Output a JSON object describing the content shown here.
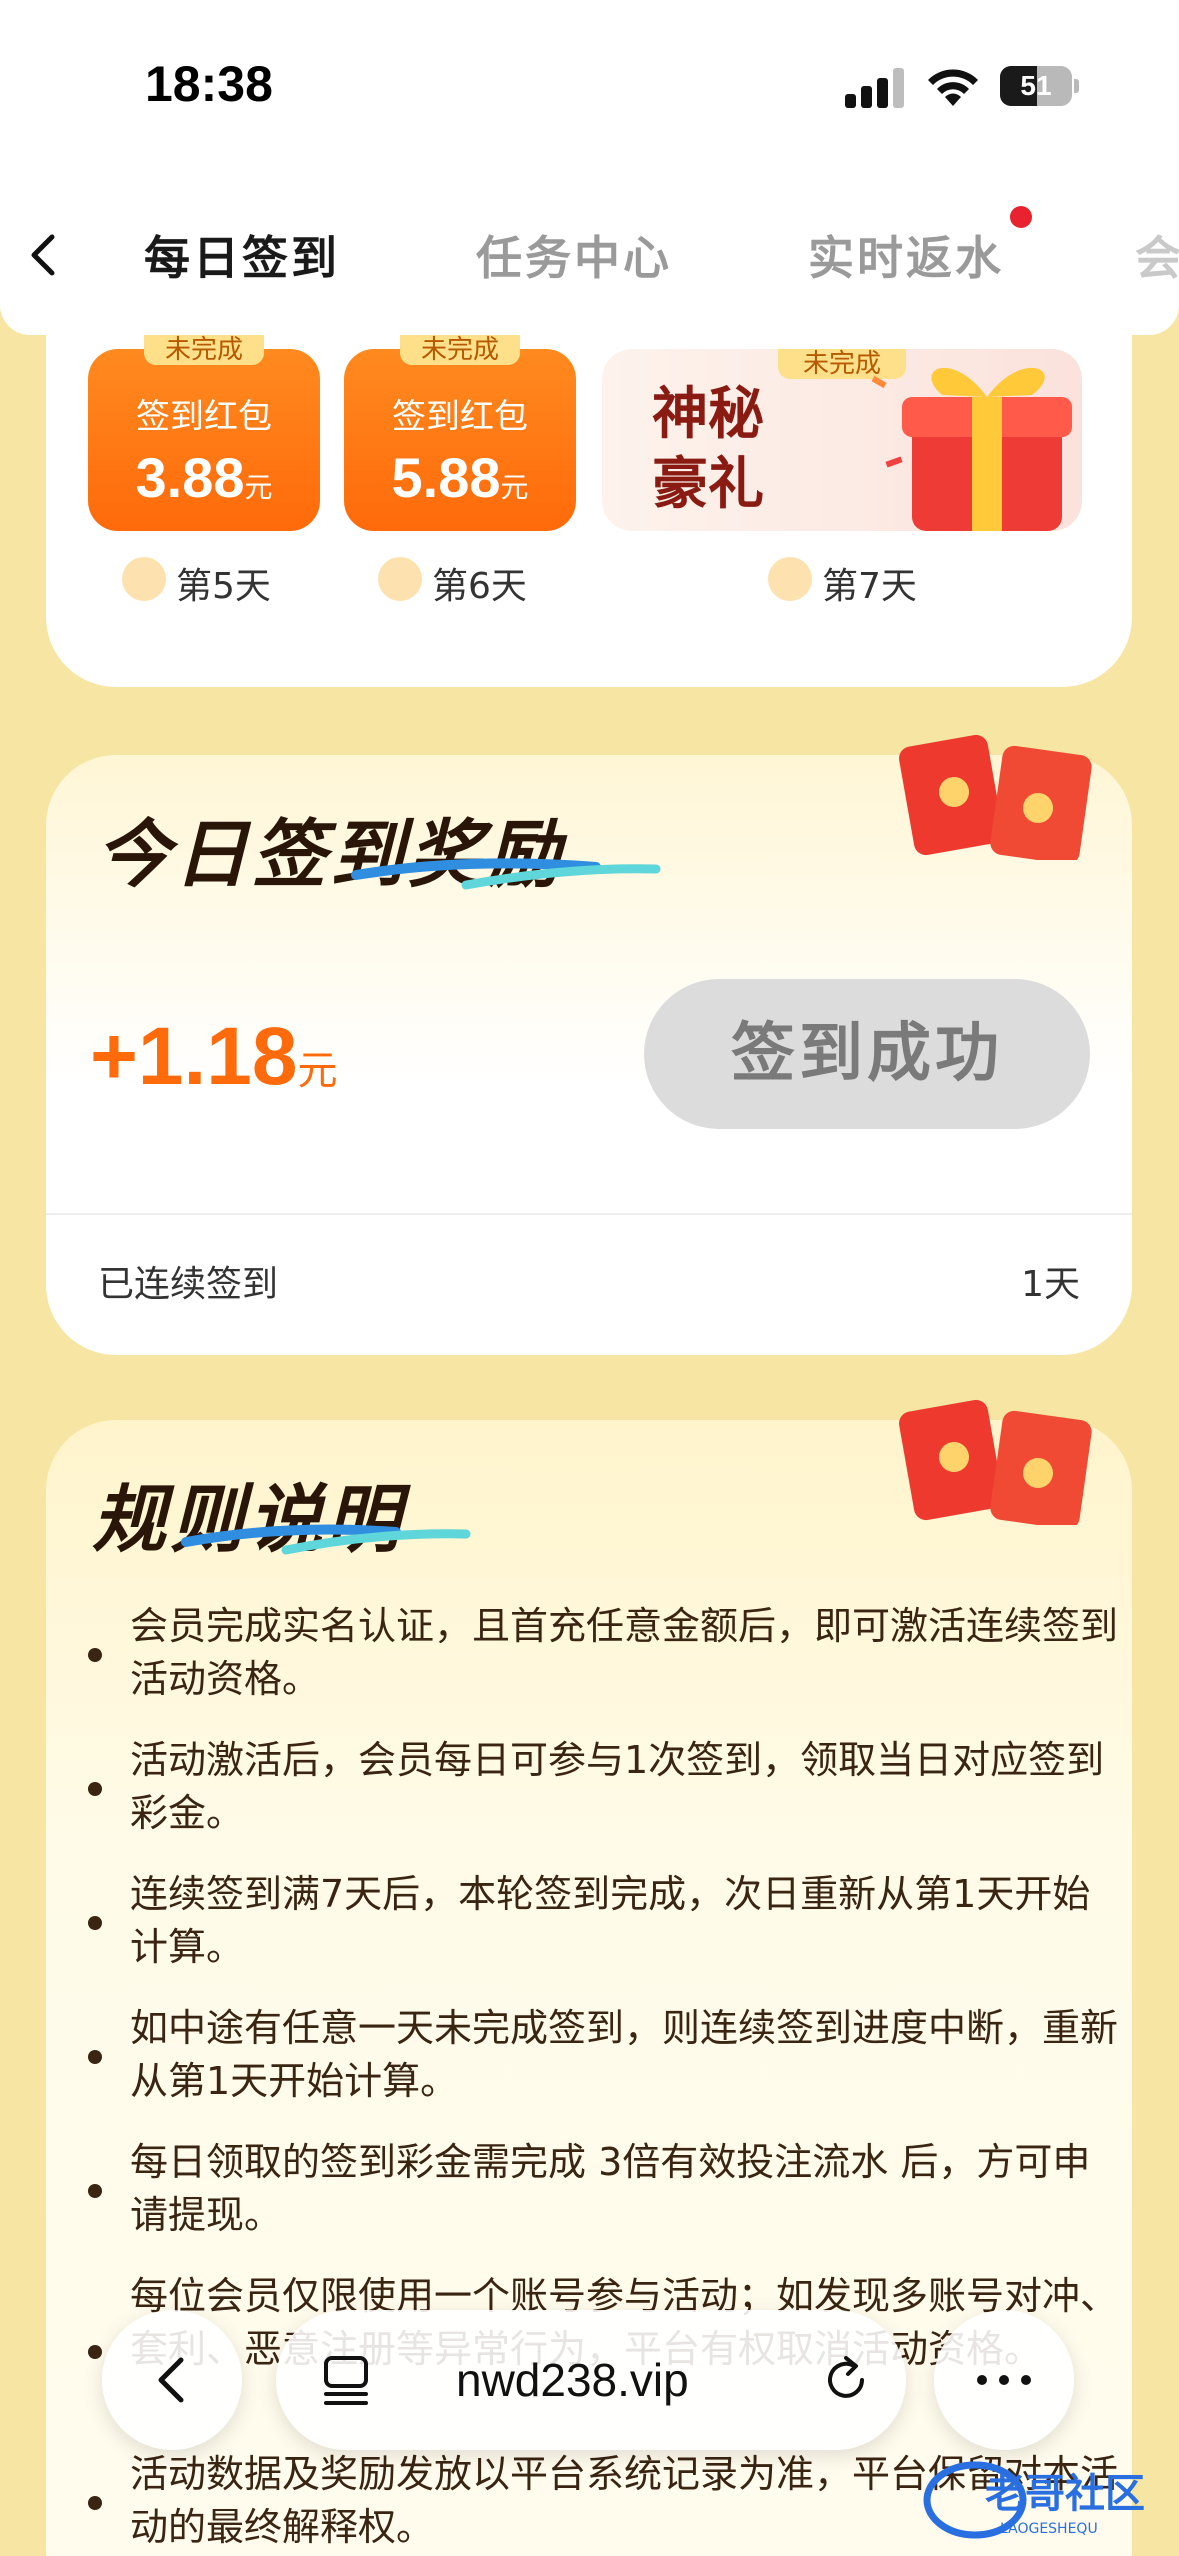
{
  "status": {
    "time": "18:38",
    "battery": "51",
    "battery_level": 0.51
  },
  "tabs": [
    {
      "label": "每日签到",
      "active": true
    },
    {
      "label": "任务中心",
      "active": false
    },
    {
      "label": "实时返水",
      "active": false,
      "has_dot": true
    }
  ],
  "days": [
    {
      "tag": "未完成",
      "title": "签到红包",
      "amount": "3.88",
      "unit": "元",
      "day": "第5天"
    },
    {
      "tag": "未完成",
      "title": "签到红包",
      "amount": "5.88",
      "unit": "元",
      "day": "第6天"
    },
    {
      "tag": "未完成",
      "title": "神秘豪礼",
      "day": "第7天"
    }
  ],
  "reward": {
    "title": "今日签到奖励",
    "amount": "+1.18",
    "unit": "元",
    "button": "签到成功",
    "streak_label": "已连续签到",
    "streak_value": "1天"
  },
  "rules": {
    "title": "规则说明",
    "items": [
      "会员完成实名认证，且首充任意金额后，即可激活连续签到活动资格。",
      "活动激活后，会员每日可参与1次签到，领取当日对应签到彩金。",
      "连续签到满7天后，本轮签到完成，次日重新从第1天开始计算。",
      "如中途有任意一天未完成签到，则连续签到进度中断，重新从第1天开始计算。",
      "每日领取的签到彩金需完成 3倍有效投注流水 后，方可申请提现。",
      "每位会员仅限使用一个账号参与活动；如发现多账号对冲、套利、恶意注册等异常行为，平台有权取消活动资格。",
      "活动数据及奖励发放以平台系统记录为准，平台保留对本活动的最终解释权。"
    ]
  },
  "browser": {
    "url": "nwd238.vip"
  },
  "watermark": {
    "text": "老哥社区",
    "subtext": "LAOGESHEQU"
  },
  "colors": {
    "accent": "#ff6a0a",
    "background": "#f7e6a3",
    "tab_dot": "#e8232f"
  }
}
